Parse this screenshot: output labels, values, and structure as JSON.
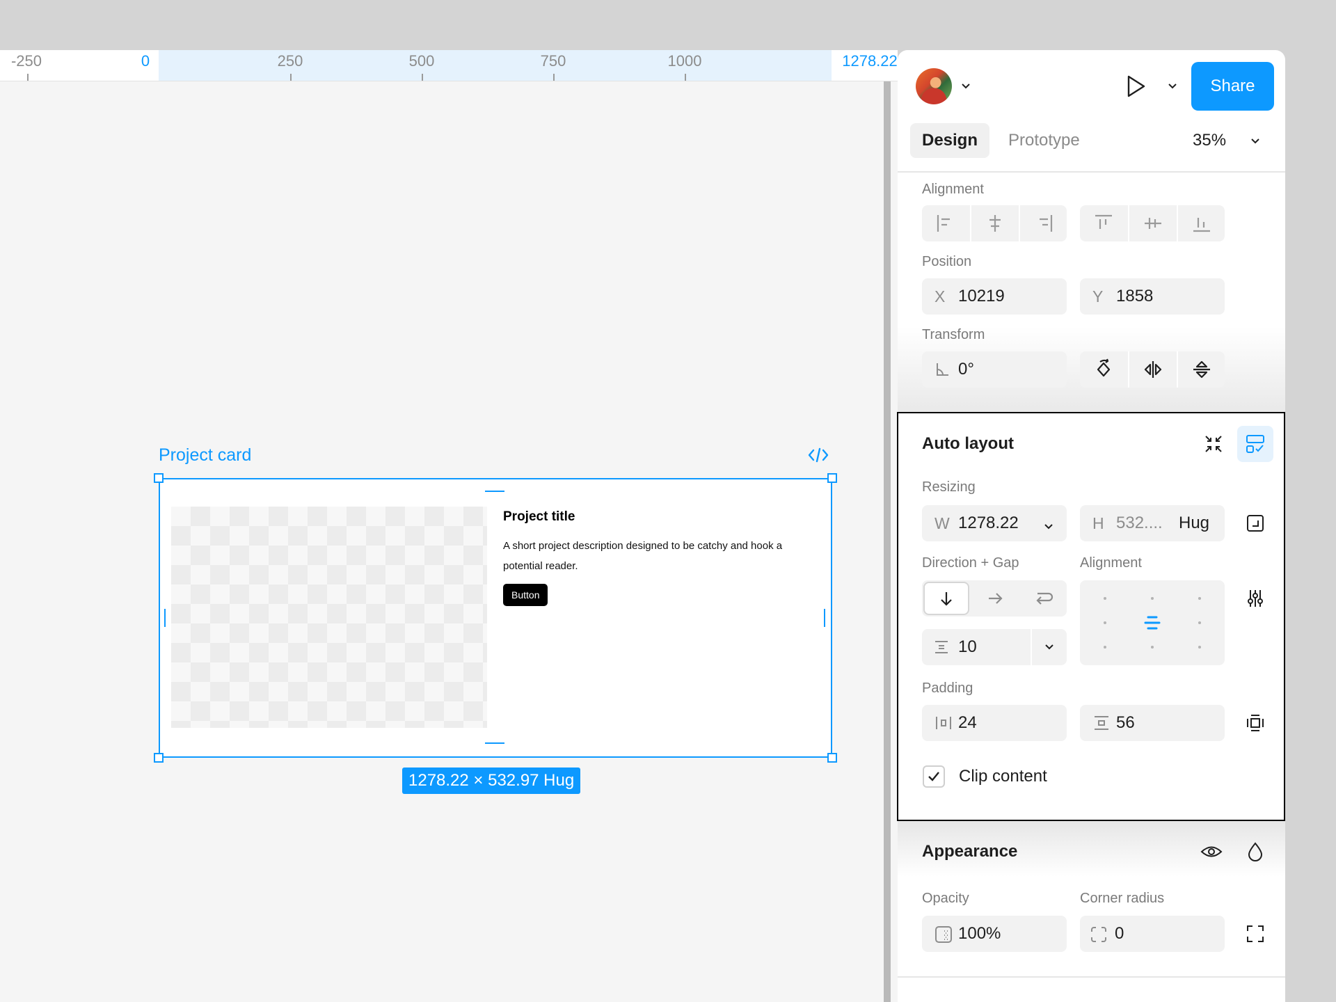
{
  "ruler": {
    "labels": [
      "-250",
      "0",
      "250",
      "500",
      "750",
      "1000",
      "1278.22"
    ]
  },
  "canvas": {
    "frame_label": "Project card",
    "size_badge": "1278.22 × 532.97 Hug",
    "card": {
      "title": "Project title",
      "description": "A short project description designed to be catchy and hook a potential reader.",
      "button_label": "Button"
    }
  },
  "toolbar": {
    "share_label": "Share",
    "tabs": [
      "Design",
      "Prototype"
    ],
    "zoom": "35%"
  },
  "alignment": {
    "title": "Alignment",
    "buttons": [
      "align-left",
      "align-horizontal-center",
      "align-right",
      "align-top",
      "align-vertical-center",
      "align-bottom"
    ]
  },
  "position": {
    "title": "Position",
    "x_prefix": "X",
    "x_value": "10219",
    "y_prefix": "Y",
    "y_value": "1858"
  },
  "transform": {
    "title": "Transform",
    "rotation": "0°"
  },
  "auto_layout": {
    "title": "Auto layout",
    "resizing_label": "Resizing",
    "w_prefix": "W",
    "w_value": "1278.22",
    "h_prefix": "H",
    "h_value": "532....",
    "h_mode": "Hug",
    "direction_gap_label": "Direction + Gap",
    "alignment_label": "Alignment",
    "gap_value": "10",
    "padding_label": "Padding",
    "padding_horizontal": "24",
    "padding_vertical": "56",
    "clip_content_label": "Clip content",
    "clip_content_checked": true,
    "selected_direction": "vertical"
  },
  "appearance": {
    "title": "Appearance",
    "opacity_label": "Opacity",
    "opacity_value": "100%",
    "corner_radius_label": "Corner radius",
    "corner_radius_value": "0"
  },
  "colors": {
    "accent": "#0d99ff",
    "canvas_bg": "#f5f5f5",
    "panel_bg": "#ffffff",
    "field_bg": "#f2f2f2"
  }
}
